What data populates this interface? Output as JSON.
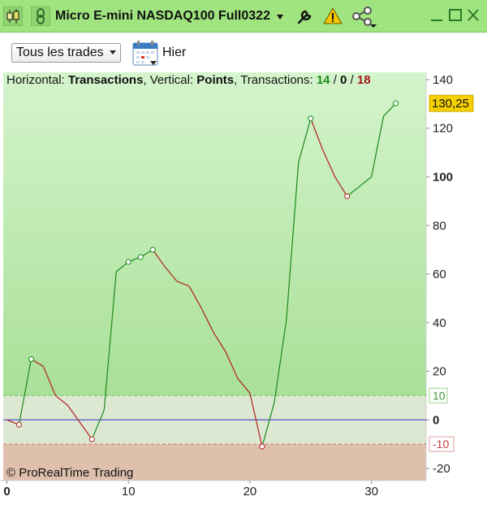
{
  "window": {
    "title": "Micro E-mini NASDAQ100 Full0322",
    "icons": [
      "candlestick-chart-icon",
      "link-chain-icon",
      "wrench-icon",
      "warning-icon",
      "share-icon",
      "minimize-icon",
      "maximize-icon",
      "close-icon"
    ]
  },
  "toolbar": {
    "trade_filter": "Tous les trades",
    "date_label": "Hier"
  },
  "legend": {
    "horizontal_label": "Horizontal: ",
    "horizontal_value": "Transactions",
    "vertical_label": ", Vertical: ",
    "vertical_value": "Points",
    "transactions_label": ", Transactions: ",
    "count_won": "14",
    "sep1": " / ",
    "count_neutral": "0",
    "sep2": " / ",
    "count_lost": "18"
  },
  "copyright": "© ProRealTime Trading",
  "colors": {
    "titlebar": "#9fe47f",
    "up_line": "#1a8a1a",
    "down_line": "#b02020",
    "zero_line": "#3333cc",
    "current_value_bg": "#f5d000"
  },
  "chart_data": {
    "type": "line",
    "x": [
      0,
      1,
      2,
      3,
      4,
      5,
      6,
      7,
      8,
      9,
      10,
      11,
      12,
      13,
      14,
      15,
      16,
      17,
      18,
      19,
      20,
      21,
      22,
      23,
      24,
      25,
      26,
      27,
      28,
      29,
      30,
      31,
      32
    ],
    "y": [
      0,
      -2,
      25,
      22,
      10,
      6,
      -1,
      -8,
      4,
      61,
      65,
      67,
      70,
      63,
      57,
      55,
      46,
      36,
      28,
      17,
      11,
      -11,
      7,
      41,
      106,
      124,
      111,
      100,
      92,
      96,
      100,
      125,
      130.25
    ],
    "xlim": [
      -0.3,
      34.5
    ],
    "ylim": [
      -25,
      143
    ],
    "x_ticks": [
      "0",
      "10",
      "20",
      "30"
    ],
    "y_ticks": [
      "140",
      "120",
      "100",
      "80",
      "60",
      "40",
      "20",
      "0",
      "-20"
    ],
    "upper_threshold": 10,
    "lower_threshold": -10,
    "upper_threshold_label": "10",
    "lower_threshold_label": "-10",
    "current_value": "130,25",
    "grid": false
  }
}
